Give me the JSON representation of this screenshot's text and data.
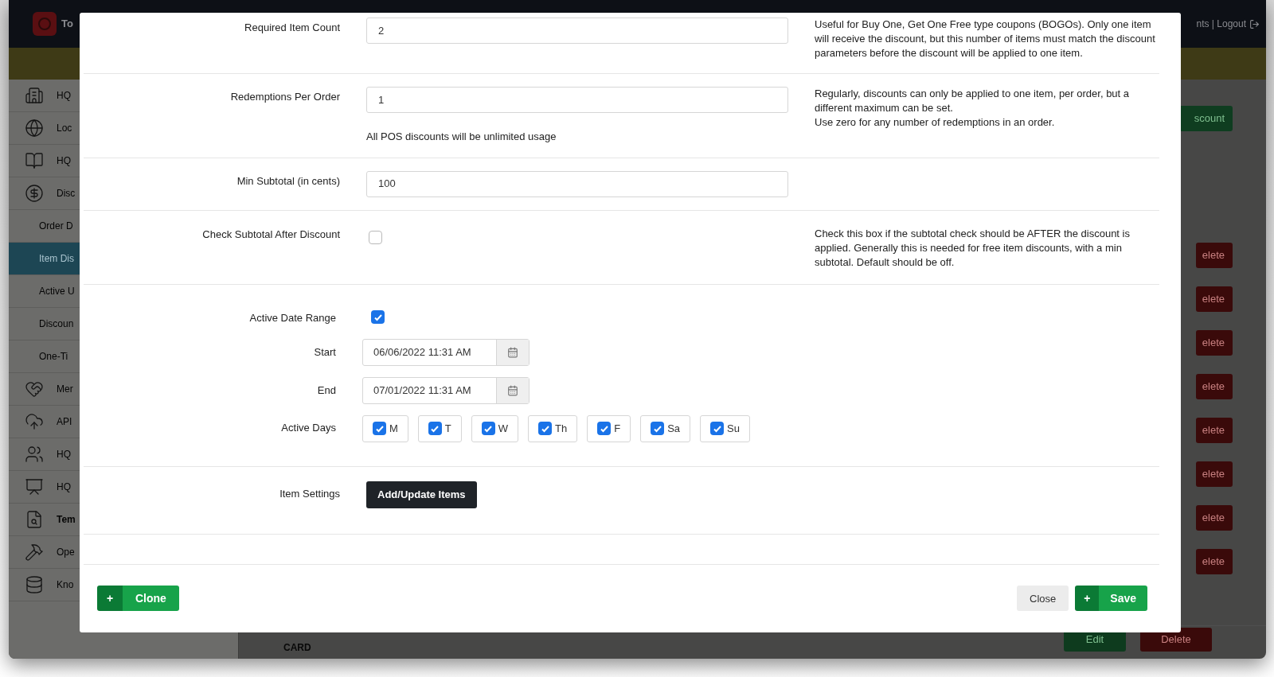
{
  "background": {
    "brand": "To",
    "header_links": "nts | Logout",
    "sidebar": [
      {
        "label": "HQ",
        "kind": "section",
        "selected": false
      },
      {
        "label": "Loc",
        "kind": "section",
        "selected": false
      },
      {
        "label": "HQ",
        "kind": "section",
        "selected": false
      },
      {
        "label": "Disc",
        "kind": "section",
        "selected": false
      },
      {
        "label": "Order D",
        "kind": "sub",
        "selected": false
      },
      {
        "label": "Item Dis",
        "kind": "sub",
        "selected": true
      },
      {
        "label": "Active U",
        "kind": "sub",
        "selected": false
      },
      {
        "label": "Discoun",
        "kind": "sub",
        "selected": false
      },
      {
        "label": "One-Ti",
        "kind": "sub",
        "selected": false
      },
      {
        "label": "Mer",
        "kind": "section",
        "selected": false
      },
      {
        "label": "API",
        "kind": "section",
        "selected": false
      },
      {
        "label": "HQ",
        "kind": "section",
        "selected": false
      },
      {
        "label": "HQ",
        "kind": "section",
        "selected": false
      },
      {
        "label": "Tem",
        "kind": "section",
        "selected": false
      },
      {
        "label": "Ope",
        "kind": "section",
        "selected": false
      },
      {
        "label": "Kno",
        "kind": "section",
        "selected": false
      }
    ],
    "action_button": "scount",
    "delete_buttons": [
      "elete",
      "elete",
      "elete",
      "elete",
      "elete",
      "elete",
      "elete",
      "elete"
    ],
    "last_row": {
      "name": "CARD",
      "edit": "Edit",
      "delete": "Delete"
    }
  },
  "modal": {
    "rows": [
      {
        "kind": "number",
        "label": "Required Item Count",
        "value": "2",
        "help": [
          "Useful for Buy One, Get One Free type coupons (BOGOs). Only one item will receive the discount, but this number of items must match the discount parameters before the discount will be applied to one item."
        ]
      },
      {
        "kind": "number",
        "label": "Redemptions Per Order",
        "value": "1",
        "note": "All POS discounts will be unlimited usage",
        "help": [
          "Regularly, discounts can only be applied to one item, per order, but a different maximum can be set.",
          "Use zero for any number of redemptions in an order."
        ]
      },
      {
        "kind": "number",
        "label": "Min Subtotal (in cents)",
        "value": "100"
      },
      {
        "kind": "checkbox",
        "label": "Check Subtotal After Discount",
        "checked": false,
        "help": [
          "Check this box if the subtotal check should be AFTER the discount is applied. Generally this is needed for free item discounts, with a min subtotal. Default should be off."
        ]
      },
      {
        "kind": "date_range",
        "label": "Active Date Range",
        "checked": true,
        "start_label": "Start",
        "start": "06/06/2022 11:31 AM",
        "end_label": "End",
        "end": "07/01/2022 11:31 AM",
        "days_label": "Active Days",
        "days": [
          {
            "label": "M",
            "checked": true
          },
          {
            "label": "T",
            "checked": true
          },
          {
            "label": "W",
            "checked": true
          },
          {
            "label": "Th",
            "checked": true
          },
          {
            "label": "F",
            "checked": true
          },
          {
            "label": "Sa",
            "checked": true
          },
          {
            "label": "Su",
            "checked": true
          }
        ]
      },
      {
        "kind": "button",
        "label": "Item Settings",
        "button": "Add/Update Items"
      }
    ],
    "footer": {
      "clone": {
        "icon": "+",
        "label": "Clone"
      },
      "close": "Close",
      "save": {
        "icon": "+",
        "label": "Save"
      }
    }
  }
}
